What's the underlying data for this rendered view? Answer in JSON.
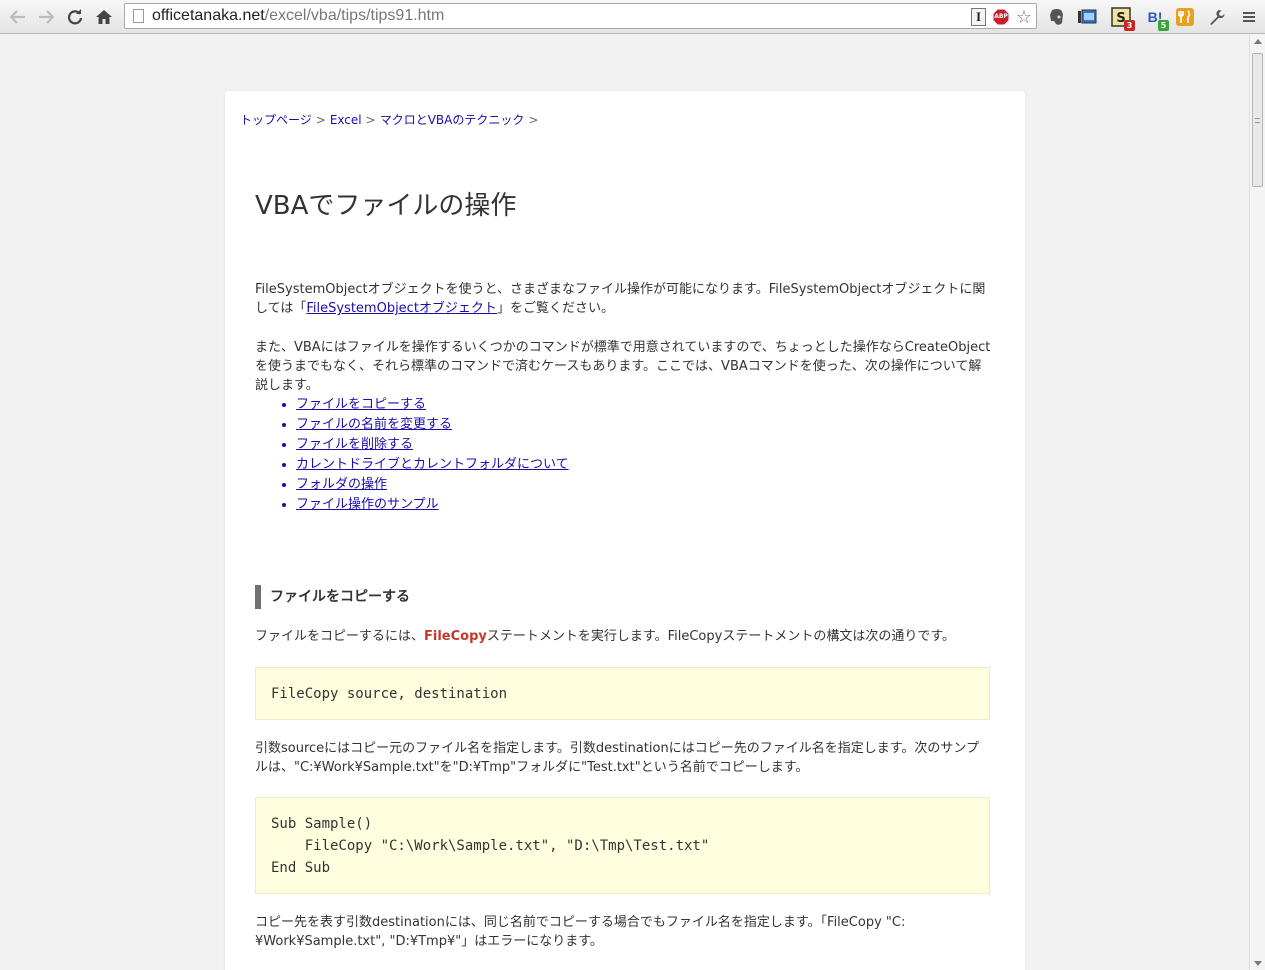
{
  "browser": {
    "url_host": "officetanaka.net",
    "url_path": "/excel/vba/tips/tips91.htm",
    "ext_i_label": "I",
    "abp_label": "ABP",
    "badge_1": "3",
    "badge_2": "5",
    "hatena_label": "B!"
  },
  "breadcrumb": {
    "items": [
      "トップページ",
      "Excel",
      "マクロとVBAのテクニック"
    ],
    "separator": ">"
  },
  "page": {
    "title": "VBAでファイルの操作",
    "intro_1_before": "FileSystemObjectオブジェクトを使うと、さまざまなファイル操作が可能になります。FileSystemObjectオブジェクトに関しては「",
    "intro_1_link": "FileSystemObjectオブジェクト",
    "intro_1_after": "」をご覧ください。",
    "intro_2": "また、VBAにはファイルを操作するいくつかのコマンドが標準で用意されていますので、ちょっとした操作ならCreateObjectを使うまでもなく、それら標準のコマンドで済むケースもあります。ここでは、VBAコマンドを使った、次の操作について解説します。",
    "toc": [
      "ファイルをコピーする",
      "ファイルの名前を変更する",
      "ファイルを削除する",
      "カレントドライブとカレントフォルダについて",
      "フォルダの操作",
      "ファイル操作のサンプル"
    ]
  },
  "section_copy": {
    "heading": "ファイルをコピーする",
    "p1_before": "ファイルをコピーするには、",
    "p1_keyword": "FileCopy",
    "p1_after": "ステートメントを実行します。FileCopyステートメントの構文は次の通りです。",
    "syntax": "FileCopy source, destination",
    "p2": "引数sourceにはコピー元のファイル名を指定します。引数destinationにはコピー先のファイル名を指定します。次のサンプルは、\"C:¥Work¥Sample.txt\"を\"D:¥Tmp\"フォルダに\"Test.txt\"という名前でコピーします。",
    "sample_code": "Sub Sample()\n    FileCopy \"C:\\Work\\Sample.txt\", \"D:\\Tmp\\Test.txt\"\nEnd Sub",
    "p3": "コピー先を表す引数destinationには、同じ名前でコピーする場合でもファイル名を指定します。「FileCopy \"C:¥Work¥Sample.txt\", \"D:¥Tmp¥\"」はエラーになります。"
  }
}
